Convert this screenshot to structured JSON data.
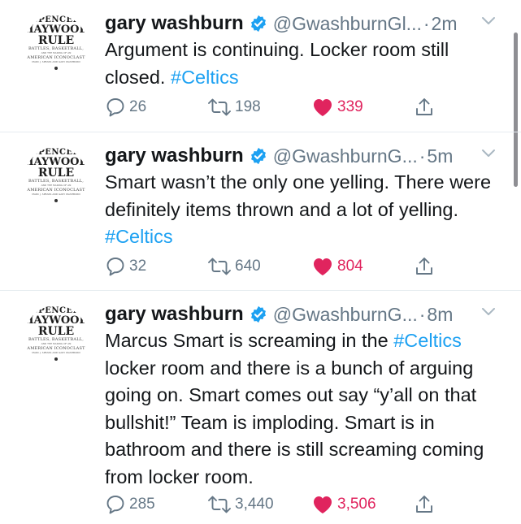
{
  "colors": {
    "hashtag": "#1da1f2",
    "like": "#e0245e",
    "verified": "#1da1f2",
    "meta": "#657786"
  },
  "avatar_text": {
    "line1": "SPENCER",
    "line2": "HAYWOOD",
    "line3": "RULE",
    "line4": "BATTLES, BASKETBALL,",
    "line5": "AND THE MAKING OF AN",
    "line6": "AMERICAN ICONOCLAST",
    "line7": "MARC J. SPEARS AND GARY WASHBURN"
  },
  "tweets": [
    {
      "name": "gary washburn",
      "handle": "@GwashburnGl...",
      "dot": "·",
      "time": "2m",
      "text": "Argument is continuing. Locker room still closed. ",
      "hashtag": "#Celtics",
      "replies": "26",
      "retweets": "198",
      "likes": "339"
    },
    {
      "name": "gary washburn",
      "handle": "@GwashburnG...",
      "dot": "·",
      "time": "5m",
      "text": "Smart wasn’t the only one yelling. There were definitely items thrown and a lot of yelling. ",
      "hashtag": "#Celtics",
      "replies": "32",
      "retweets": "640",
      "likes": "804"
    },
    {
      "name": "gary washburn",
      "handle": "@GwashburnG...",
      "dot": "·",
      "time": "8m",
      "text_before": "Marcus Smart is screaming in the ",
      "hashtag": "#Celtics",
      "text_after": " locker room and there is a bunch of arguing going on. Smart comes out say “y’all on that bullshit!” Team is imploding. Smart is in bathroom and there is still screaming coming from locker room.",
      "replies": "285",
      "retweets": "3,440",
      "likes": "3,506"
    }
  ]
}
